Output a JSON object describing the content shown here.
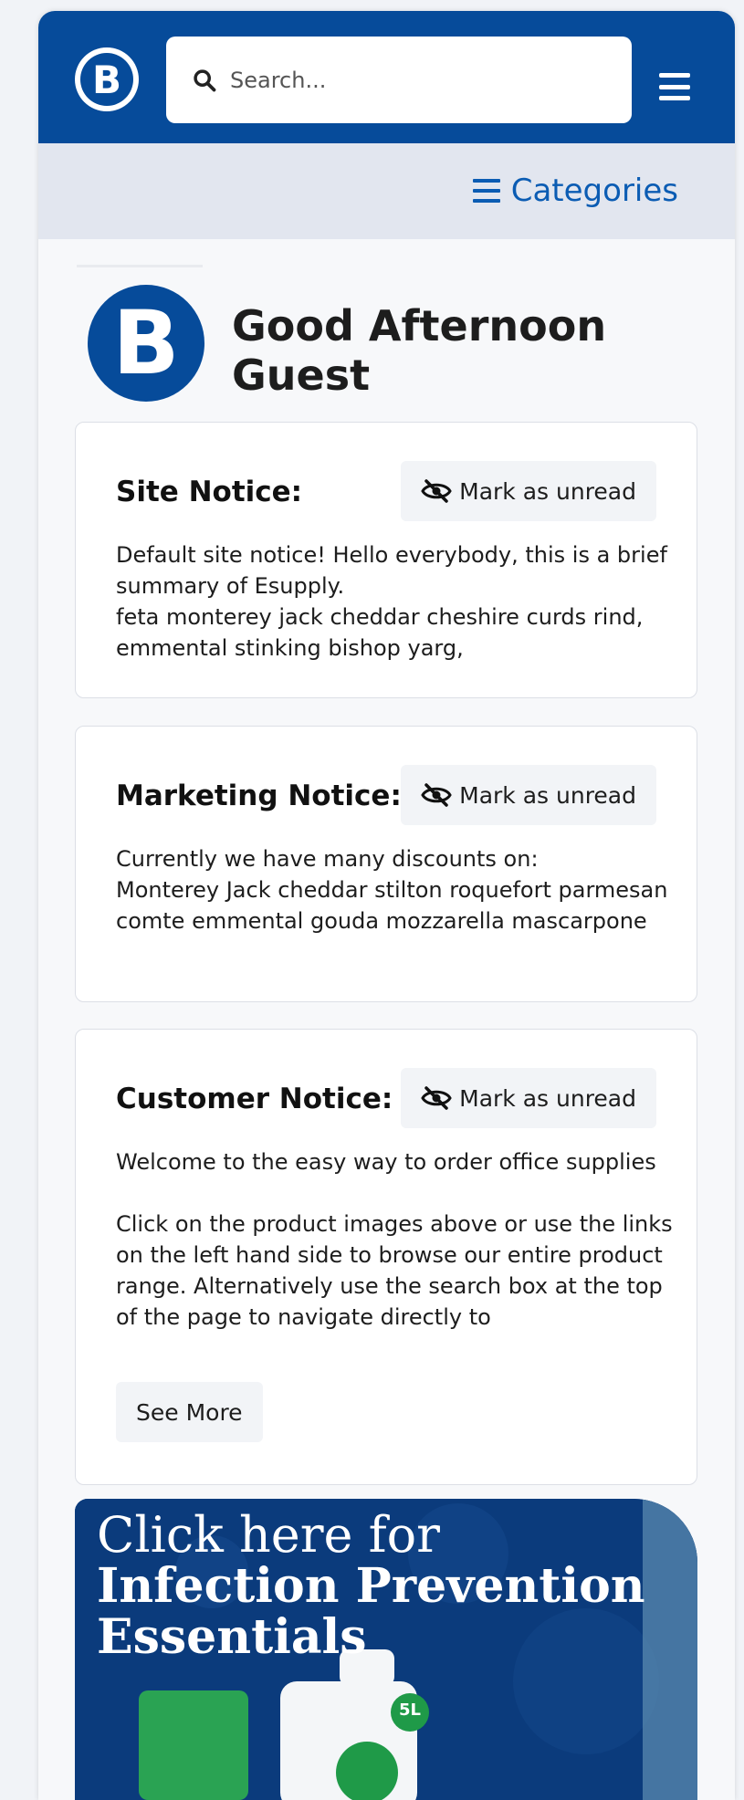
{
  "header": {
    "logo_letter": "B",
    "search_placeholder": "Search...",
    "categories_label": "Categories"
  },
  "greeting": {
    "logo_letter": "B",
    "text": "Good Afternoon Guest"
  },
  "notices": [
    {
      "title": "Site Notice:",
      "button_label": "Mark as unread",
      "lines": [
        "Default site notice! Hello everybody, this is a brief summary of Esupply.",
        "feta monterey jack cheddar cheshire curds rind, emmental stinking bishop yarg,"
      ]
    },
    {
      "title": "Marketing Notice:",
      "button_label": "Mark as unread",
      "lines": [
        "Currently we have many discounts on:",
        "Monterey Jack cheddar stilton roquefort parmesan comte emmental gouda mozzarella mascarpone"
      ]
    },
    {
      "title": "Customer Notice:",
      "button_label": "Mark as unread",
      "lines": [
        "Welcome to the easy way to order office supplies",
        "Click on the product images above or use the links on the left hand side to browse our entire product range. Alternatively use the search box at the top of the page to navigate directly to"
      ],
      "see_more_label": "See More"
    }
  ],
  "banner": {
    "line1": "Click here for",
    "line2": "Infection Prevention",
    "line3": "Essentials",
    "badge": "5L"
  },
  "colors": {
    "brand_blue": "#064b9a",
    "link_blue": "#0b5cb3"
  }
}
